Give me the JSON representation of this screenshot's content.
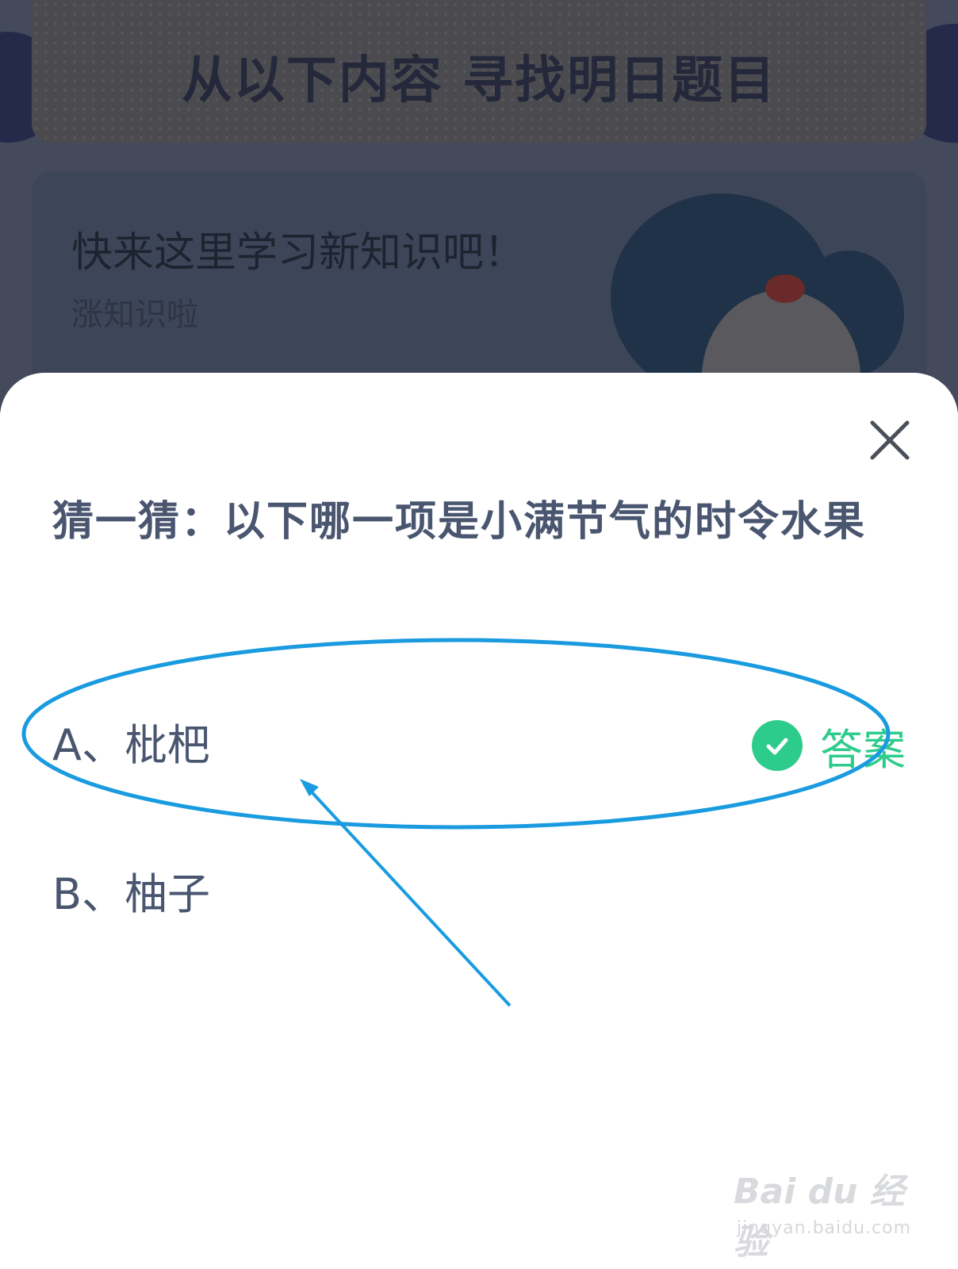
{
  "background": {
    "header_title": "从以下内容 寻找明日题目",
    "study_card": {
      "title": "快来这里学习新知识吧！",
      "subtitle": "涨知识啦"
    }
  },
  "dialog": {
    "question": "猜一猜：以下哪一项是小满节气的时令水果",
    "options": [
      {
        "label": "A、枇杷",
        "is_answer": true
      },
      {
        "label": "B、柚子",
        "is_answer": false
      }
    ],
    "answer_label": "答案",
    "colors": {
      "question_text": "#4a5670",
      "answer_green": "#2ecc8c",
      "annotation_blue": "#1a9be0"
    },
    "icons": {
      "close": "close-icon",
      "answer": "check-circle-icon"
    }
  },
  "watermark": {
    "brand": "Bai du 经验",
    "url": "jingyan.baidu.com"
  }
}
